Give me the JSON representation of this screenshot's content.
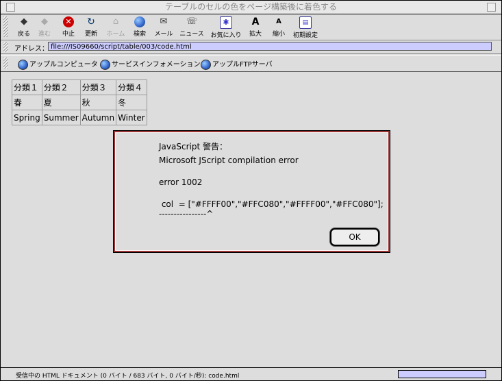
{
  "window": {
    "title": "テーブルのセルの色をページ構築後に着色する"
  },
  "toolbar": {
    "back": "戻る",
    "forward": "進む",
    "stop": "中止",
    "refresh": "更新",
    "home": "ホーム",
    "search": "検索",
    "mail": "メール",
    "news": "ニュース",
    "favorites": "お気に入り",
    "zoom_in": "拡大",
    "zoom_out": "縮小",
    "preferences": "初期設定"
  },
  "address": {
    "label": "アドレス：",
    "value": "file:///IS09660/script/table/003/code.html"
  },
  "favorites_bar": {
    "items": [
      "アップルコンピュータ",
      "サービスインフォメーション",
      "アップルFTPサーバ"
    ]
  },
  "table": {
    "rows": [
      [
        "分類１",
        "分類２",
        "分類３",
        "分類４"
      ],
      [
        "春",
        "夏",
        "秋",
        "冬"
      ],
      [
        "Spring",
        "Summer",
        "Autumn",
        "Winter"
      ]
    ]
  },
  "dialog": {
    "heading": "JavaScript 警告：",
    "message": "Microsoft JScript compilation error",
    "error_code": "error 1002",
    "code_line": " col  = [\"#FFFF00\",\"#FFC080\",\"#FFFF00\",\"#FFC080\"];",
    "pointer_line": "----------------^",
    "ok_label": "OK"
  },
  "status": {
    "text": "受信中の HTML ドキュメント (0 バイト / 683 バイト, 0 バイト/秒): code.html"
  }
}
